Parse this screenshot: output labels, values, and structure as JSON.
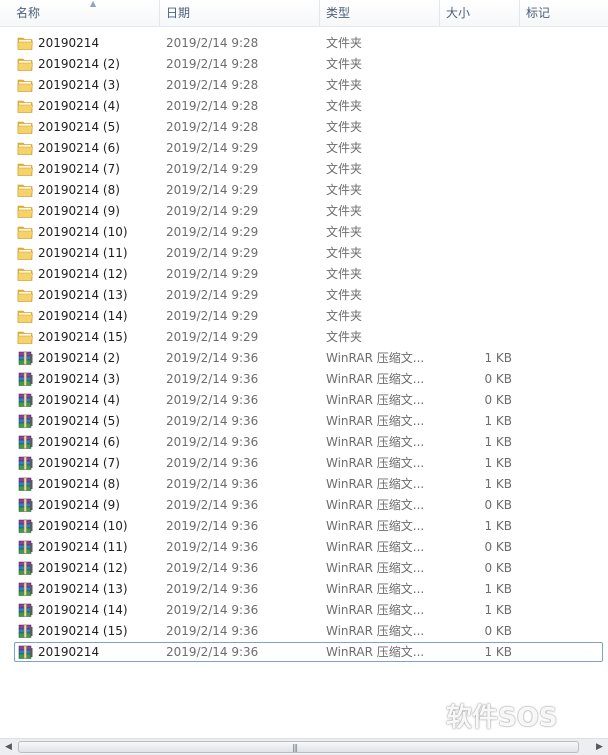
{
  "columns": {
    "name": "名称",
    "date": "日期",
    "type": "类型",
    "size": "大小",
    "tags": "标记"
  },
  "rows": [
    {
      "name": "20190214",
      "date": "2019/2/14 9:28",
      "type": "文件夹",
      "size": "",
      "kind": "folder"
    },
    {
      "name": "20190214 (2)",
      "date": "2019/2/14 9:28",
      "type": "文件夹",
      "size": "",
      "kind": "folder"
    },
    {
      "name": "20190214 (3)",
      "date": "2019/2/14 9:28",
      "type": "文件夹",
      "size": "",
      "kind": "folder"
    },
    {
      "name": "20190214 (4)",
      "date": "2019/2/14 9:28",
      "type": "文件夹",
      "size": "",
      "kind": "folder"
    },
    {
      "name": "20190214 (5)",
      "date": "2019/2/14 9:28",
      "type": "文件夹",
      "size": "",
      "kind": "folder"
    },
    {
      "name": "20190214 (6)",
      "date": "2019/2/14 9:29",
      "type": "文件夹",
      "size": "",
      "kind": "folder"
    },
    {
      "name": "20190214 (7)",
      "date": "2019/2/14 9:29",
      "type": "文件夹",
      "size": "",
      "kind": "folder"
    },
    {
      "name": "20190214 (8)",
      "date": "2019/2/14 9:29",
      "type": "文件夹",
      "size": "",
      "kind": "folder"
    },
    {
      "name": "20190214 (9)",
      "date": "2019/2/14 9:29",
      "type": "文件夹",
      "size": "",
      "kind": "folder"
    },
    {
      "name": "20190214 (10)",
      "date": "2019/2/14 9:29",
      "type": "文件夹",
      "size": "",
      "kind": "folder"
    },
    {
      "name": "20190214 (11)",
      "date": "2019/2/14 9:29",
      "type": "文件夹",
      "size": "",
      "kind": "folder"
    },
    {
      "name": "20190214 (12)",
      "date": "2019/2/14 9:29",
      "type": "文件夹",
      "size": "",
      "kind": "folder"
    },
    {
      "name": "20190214 (13)",
      "date": "2019/2/14 9:29",
      "type": "文件夹",
      "size": "",
      "kind": "folder"
    },
    {
      "name": "20190214 (14)",
      "date": "2019/2/14 9:29",
      "type": "文件夹",
      "size": "",
      "kind": "folder"
    },
    {
      "name": "20190214 (15)",
      "date": "2019/2/14 9:29",
      "type": "文件夹",
      "size": "",
      "kind": "folder"
    },
    {
      "name": "20190214 (2)",
      "date": "2019/2/14 9:36",
      "type": "WinRAR 压缩文...",
      "size": "1 KB",
      "kind": "archive"
    },
    {
      "name": "20190214 (3)",
      "date": "2019/2/14 9:36",
      "type": "WinRAR 压缩文...",
      "size": "0 KB",
      "kind": "archive"
    },
    {
      "name": "20190214 (4)",
      "date": "2019/2/14 9:36",
      "type": "WinRAR 压缩文...",
      "size": "0 KB",
      "kind": "archive"
    },
    {
      "name": "20190214 (5)",
      "date": "2019/2/14 9:36",
      "type": "WinRAR 压缩文...",
      "size": "1 KB",
      "kind": "archive"
    },
    {
      "name": "20190214 (6)",
      "date": "2019/2/14 9:36",
      "type": "WinRAR 压缩文...",
      "size": "1 KB",
      "kind": "archive"
    },
    {
      "name": "20190214 (7)",
      "date": "2019/2/14 9:36",
      "type": "WinRAR 压缩文...",
      "size": "1 KB",
      "kind": "archive"
    },
    {
      "name": "20190214 (8)",
      "date": "2019/2/14 9:36",
      "type": "WinRAR 压缩文...",
      "size": "1 KB",
      "kind": "archive"
    },
    {
      "name": "20190214 (9)",
      "date": "2019/2/14 9:36",
      "type": "WinRAR 压缩文...",
      "size": "0 KB",
      "kind": "archive"
    },
    {
      "name": "20190214 (10)",
      "date": "2019/2/14 9:36",
      "type": "WinRAR 压缩文...",
      "size": "1 KB",
      "kind": "archive"
    },
    {
      "name": "20190214 (11)",
      "date": "2019/2/14 9:36",
      "type": "WinRAR 压缩文...",
      "size": "0 KB",
      "kind": "archive"
    },
    {
      "name": "20190214 (12)",
      "date": "2019/2/14 9:36",
      "type": "WinRAR 压缩文...",
      "size": "0 KB",
      "kind": "archive"
    },
    {
      "name": "20190214 (13)",
      "date": "2019/2/14 9:36",
      "type": "WinRAR 压缩文...",
      "size": "1 KB",
      "kind": "archive"
    },
    {
      "name": "20190214 (14)",
      "date": "2019/2/14 9:36",
      "type": "WinRAR 压缩文...",
      "size": "1 KB",
      "kind": "archive"
    },
    {
      "name": "20190214 (15)",
      "date": "2019/2/14 9:36",
      "type": "WinRAR 压缩文...",
      "size": "0 KB",
      "kind": "archive"
    },
    {
      "name": "20190214",
      "date": "2019/2/14 9:36",
      "type": "WinRAR 压缩文...",
      "size": "1 KB",
      "kind": "archive",
      "selected": true
    }
  ],
  "icons": {
    "folder": "folder-icon",
    "archive": "winrar-archive-icon",
    "sort": "sort-ascending-icon",
    "scroll_left": "scroll-left-arrow-icon",
    "scroll_right": "scroll-right-arrow-icon"
  },
  "watermark": {
    "text": "软件SOS"
  },
  "colors": {
    "header_text": "#4c607a",
    "selection_border": "#7da2ce",
    "secondary_text": "#6d6d6d",
    "folder": "#f2c94c"
  }
}
